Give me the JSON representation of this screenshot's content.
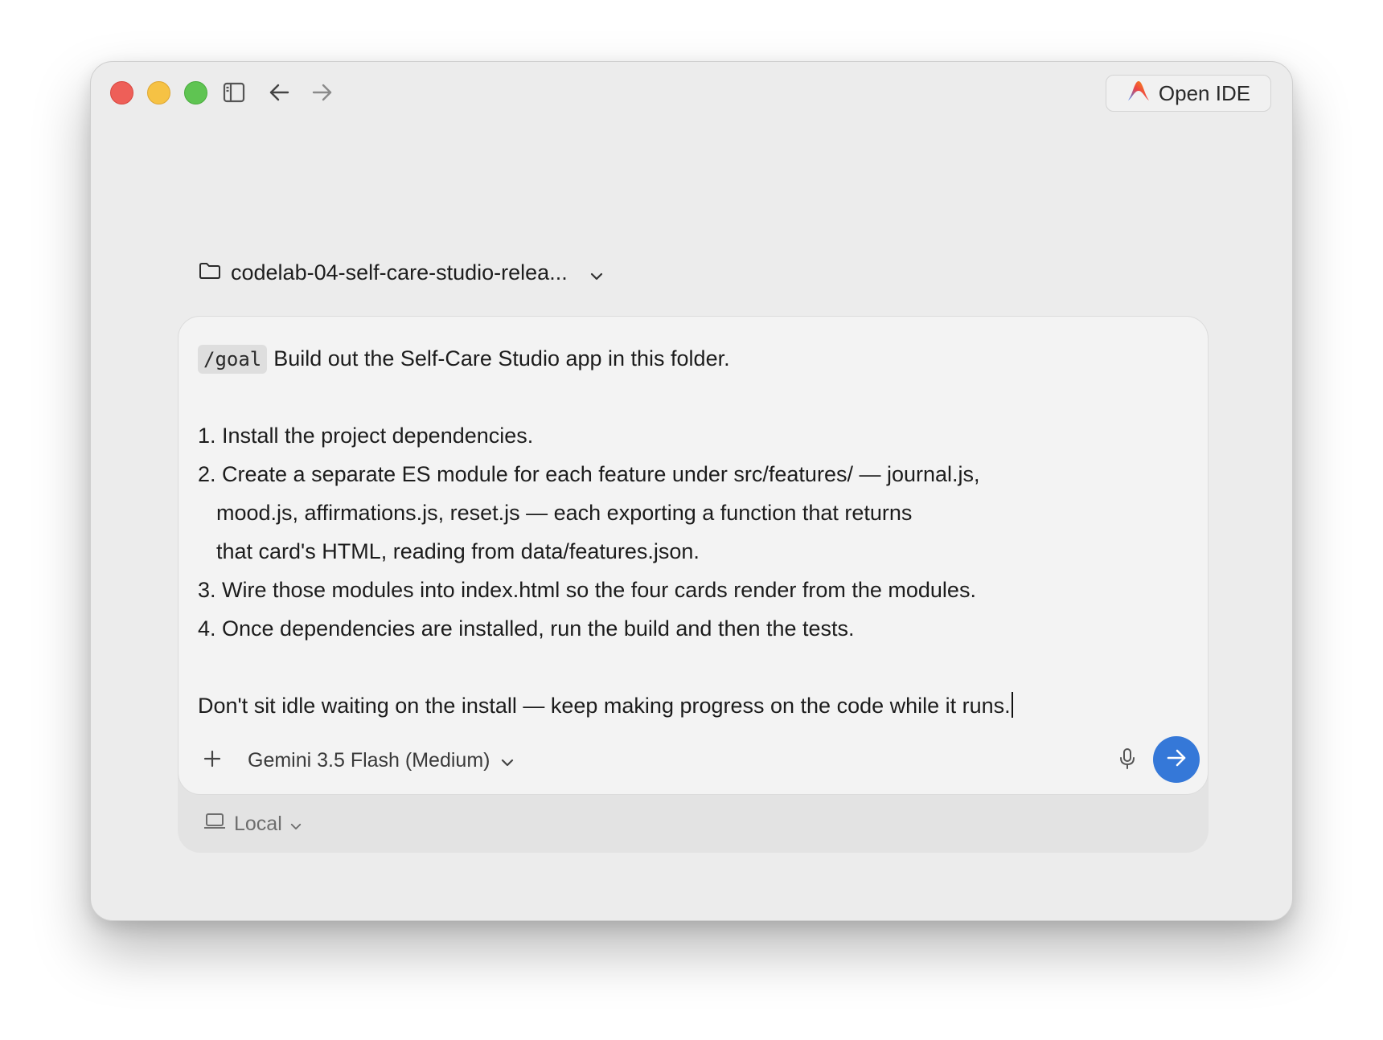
{
  "titlebar": {
    "sidebar_icon": "sidebar-toggle-icon",
    "back_icon": "arrow-left-icon",
    "forward_icon": "arrow-right-icon",
    "open_ide_label": "Open IDE",
    "open_ide_icon": "antigravity-logo-icon"
  },
  "workspace": {
    "folder_icon": "folder-icon",
    "folder_name": "codelab-04-self-care-studio-relea...",
    "chevron_icon": "chevron-down-icon"
  },
  "composer": {
    "command_chip": "/goal",
    "lines": [
      "Build out the Self-Care Studio app in this folder.",
      "",
      "1. Install the project dependencies.",
      "2. Create a separate ES module for each feature under src/features/ — journal.js,",
      "mood.js, affirmations.js, reset.js — each exporting a function that returns",
      "that card's HTML, reading from data/features.json.",
      "3. Wire those modules into index.html so the four cards render from the modules.",
      "4. Once dependencies are installed, run the build and then the tests.",
      "",
      "Don't sit idle waiting on the install — keep making progress on the code while it runs."
    ],
    "model_label": "Gemini 3.5 Flash (Medium)",
    "add_icon": "plus-icon",
    "mic_icon": "microphone-icon",
    "send_icon": "arrow-right-icon",
    "send_color": "#3578d8"
  },
  "environment": {
    "icon": "laptop-icon",
    "label": "Local"
  },
  "colors": {
    "close": "#ee5f58",
    "minimize": "#f6c244",
    "maximize": "#5fc452"
  }
}
